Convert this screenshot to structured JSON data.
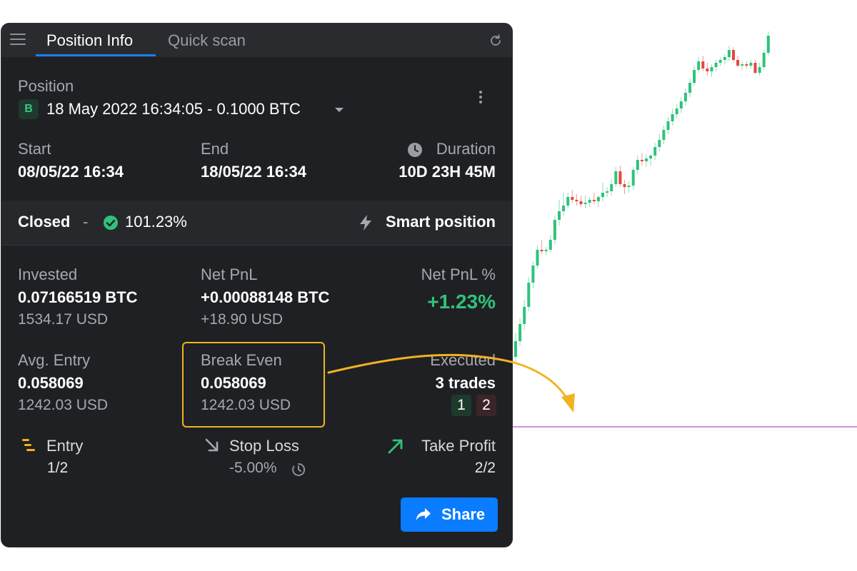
{
  "tabs": [
    {
      "label": "Position Info",
      "active": true
    },
    {
      "label": "Quick scan",
      "active": false
    }
  ],
  "position": {
    "label": "Position",
    "side_badge": "B",
    "selected": "18 May 2022 16:34:05 - 0.1000 BTC"
  },
  "timing": {
    "start_label": "Start",
    "start_value": "08/05/22 16:34",
    "end_label": "End",
    "end_value": "18/05/22 16:34",
    "duration_label": "Duration",
    "duration_value": "10D 23H 45M"
  },
  "status": {
    "state": "Closed",
    "separator": "-",
    "percent": "101.23%",
    "mode": "Smart position"
  },
  "metrics": {
    "invested_label": "Invested",
    "invested_value": "0.07166519 BTC",
    "invested_usd": "1534.17 USD",
    "netpnl_label": "Net PnL",
    "netpnl_value": "+0.00088148 BTC",
    "netpnl_usd": "+18.90 USD",
    "netpnl_pct_label": "Net PnL %",
    "netpnl_pct_value": "+1.23%",
    "avg_entry_label": "Avg. Entry",
    "avg_entry_value": "0.058069",
    "avg_entry_usd": "1242.03 USD",
    "break_even_label": "Break Even",
    "break_even_value": "0.058069",
    "break_even_usd": "1242.03 USD",
    "executed_label": "Executed",
    "executed_value": "3 trades",
    "executed_buys": "1",
    "executed_sells": "2"
  },
  "targets": {
    "entry_label": "Entry",
    "entry_value": "1/2",
    "stop_loss_label": "Stop Loss",
    "stop_loss_value": "-5.00%",
    "take_profit_label": "Take Profit",
    "take_profit_value": "2/2"
  },
  "actions": {
    "share_label": "Share"
  },
  "colors": {
    "panel_bg": "#1f2023",
    "accent_blue": "#0a7cff",
    "positive_green": "#2fc27c",
    "candle_up": "#2fc27c",
    "candle_down": "#e8453c",
    "highlight_yellow": "#f1b321",
    "price_line": "#c86ad8"
  },
  "chart_data": {
    "type": "candlestick",
    "reference_line": {
      "color": "#c86ad8"
    },
    "candles": [
      {
        "o": 500,
        "h": 506,
        "l": 466,
        "c": 478
      },
      {
        "o": 478,
        "h": 484,
        "l": 446,
        "c": 454
      },
      {
        "o": 454,
        "h": 462,
        "l": 420,
        "c": 430
      },
      {
        "o": 430,
        "h": 436,
        "l": 388,
        "c": 396
      },
      {
        "o": 396,
        "h": 404,
        "l": 366,
        "c": 372
      },
      {
        "o": 372,
        "h": 376,
        "l": 344,
        "c": 350
      },
      {
        "o": 350,
        "h": 356,
        "l": 336,
        "c": 352
      },
      {
        "o": 352,
        "h": 358,
        "l": 346,
        "c": 350
      },
      {
        "o": 350,
        "h": 354,
        "l": 330,
        "c": 336
      },
      {
        "o": 336,
        "h": 342,
        "l": 302,
        "c": 308
      },
      {
        "o": 308,
        "h": 316,
        "l": 280,
        "c": 296
      },
      {
        "o": 296,
        "h": 302,
        "l": 270,
        "c": 288
      },
      {
        "o": 288,
        "h": 292,
        "l": 270,
        "c": 276
      },
      {
        "o": 276,
        "h": 284,
        "l": 266,
        "c": 280
      },
      {
        "o": 280,
        "h": 288,
        "l": 272,
        "c": 282
      },
      {
        "o": 282,
        "h": 290,
        "l": 274,
        "c": 286
      },
      {
        "o": 286,
        "h": 292,
        "l": 274,
        "c": 284
      },
      {
        "o": 284,
        "h": 290,
        "l": 276,
        "c": 280
      },
      {
        "o": 280,
        "h": 286,
        "l": 270,
        "c": 282
      },
      {
        "o": 282,
        "h": 290,
        "l": 274,
        "c": 276
      },
      {
        "o": 276,
        "h": 282,
        "l": 256,
        "c": 270
      },
      {
        "o": 270,
        "h": 276,
        "l": 262,
        "c": 268
      },
      {
        "o": 268,
        "h": 274,
        "l": 250,
        "c": 258
      },
      {
        "o": 258,
        "h": 262,
        "l": 234,
        "c": 240
      },
      {
        "o": 240,
        "h": 262,
        "l": 232,
        "c": 258
      },
      {
        "o": 258,
        "h": 272,
        "l": 252,
        "c": 262
      },
      {
        "o": 262,
        "h": 270,
        "l": 254,
        "c": 260
      },
      {
        "o": 260,
        "h": 266,
        "l": 234,
        "c": 238
      },
      {
        "o": 238,
        "h": 244,
        "l": 218,
        "c": 224
      },
      {
        "o": 224,
        "h": 232,
        "l": 214,
        "c": 226
      },
      {
        "o": 226,
        "h": 234,
        "l": 216,
        "c": 222
      },
      {
        "o": 222,
        "h": 232,
        "l": 216,
        "c": 218
      },
      {
        "o": 218,
        "h": 224,
        "l": 200,
        "c": 206
      },
      {
        "o": 206,
        "h": 212,
        "l": 188,
        "c": 196
      },
      {
        "o": 196,
        "h": 202,
        "l": 176,
        "c": 182
      },
      {
        "o": 182,
        "h": 188,
        "l": 164,
        "c": 170
      },
      {
        "o": 170,
        "h": 176,
        "l": 152,
        "c": 160
      },
      {
        "o": 160,
        "h": 166,
        "l": 146,
        "c": 152
      },
      {
        "o": 152,
        "h": 158,
        "l": 136,
        "c": 142
      },
      {
        "o": 142,
        "h": 148,
        "l": 124,
        "c": 130
      },
      {
        "o": 130,
        "h": 136,
        "l": 110,
        "c": 116
      },
      {
        "o": 116,
        "h": 120,
        "l": 92,
        "c": 98
      },
      {
        "o": 98,
        "h": 102,
        "l": 80,
        "c": 86
      },
      {
        "o": 86,
        "h": 100,
        "l": 78,
        "c": 96
      },
      {
        "o": 96,
        "h": 106,
        "l": 88,
        "c": 100
      },
      {
        "o": 100,
        "h": 108,
        "l": 90,
        "c": 94
      },
      {
        "o": 94,
        "h": 100,
        "l": 84,
        "c": 88
      },
      {
        "o": 88,
        "h": 92,
        "l": 80,
        "c": 84
      },
      {
        "o": 84,
        "h": 90,
        "l": 76,
        "c": 80
      },
      {
        "o": 80,
        "h": 86,
        "l": 64,
        "c": 70
      },
      {
        "o": 70,
        "h": 88,
        "l": 66,
        "c": 84
      },
      {
        "o": 84,
        "h": 94,
        "l": 78,
        "c": 92
      },
      {
        "o": 92,
        "h": 98,
        "l": 86,
        "c": 90
      },
      {
        "o": 90,
        "h": 96,
        "l": 86,
        "c": 92
      },
      {
        "o": 92,
        "h": 96,
        "l": 84,
        "c": 88
      },
      {
        "o": 88,
        "h": 104,
        "l": 84,
        "c": 102
      },
      {
        "o": 102,
        "h": 106,
        "l": 88,
        "c": 94
      },
      {
        "o": 94,
        "h": 98,
        "l": 70,
        "c": 74
      },
      {
        "o": 74,
        "h": 78,
        "l": 44,
        "c": 50
      }
    ]
  }
}
